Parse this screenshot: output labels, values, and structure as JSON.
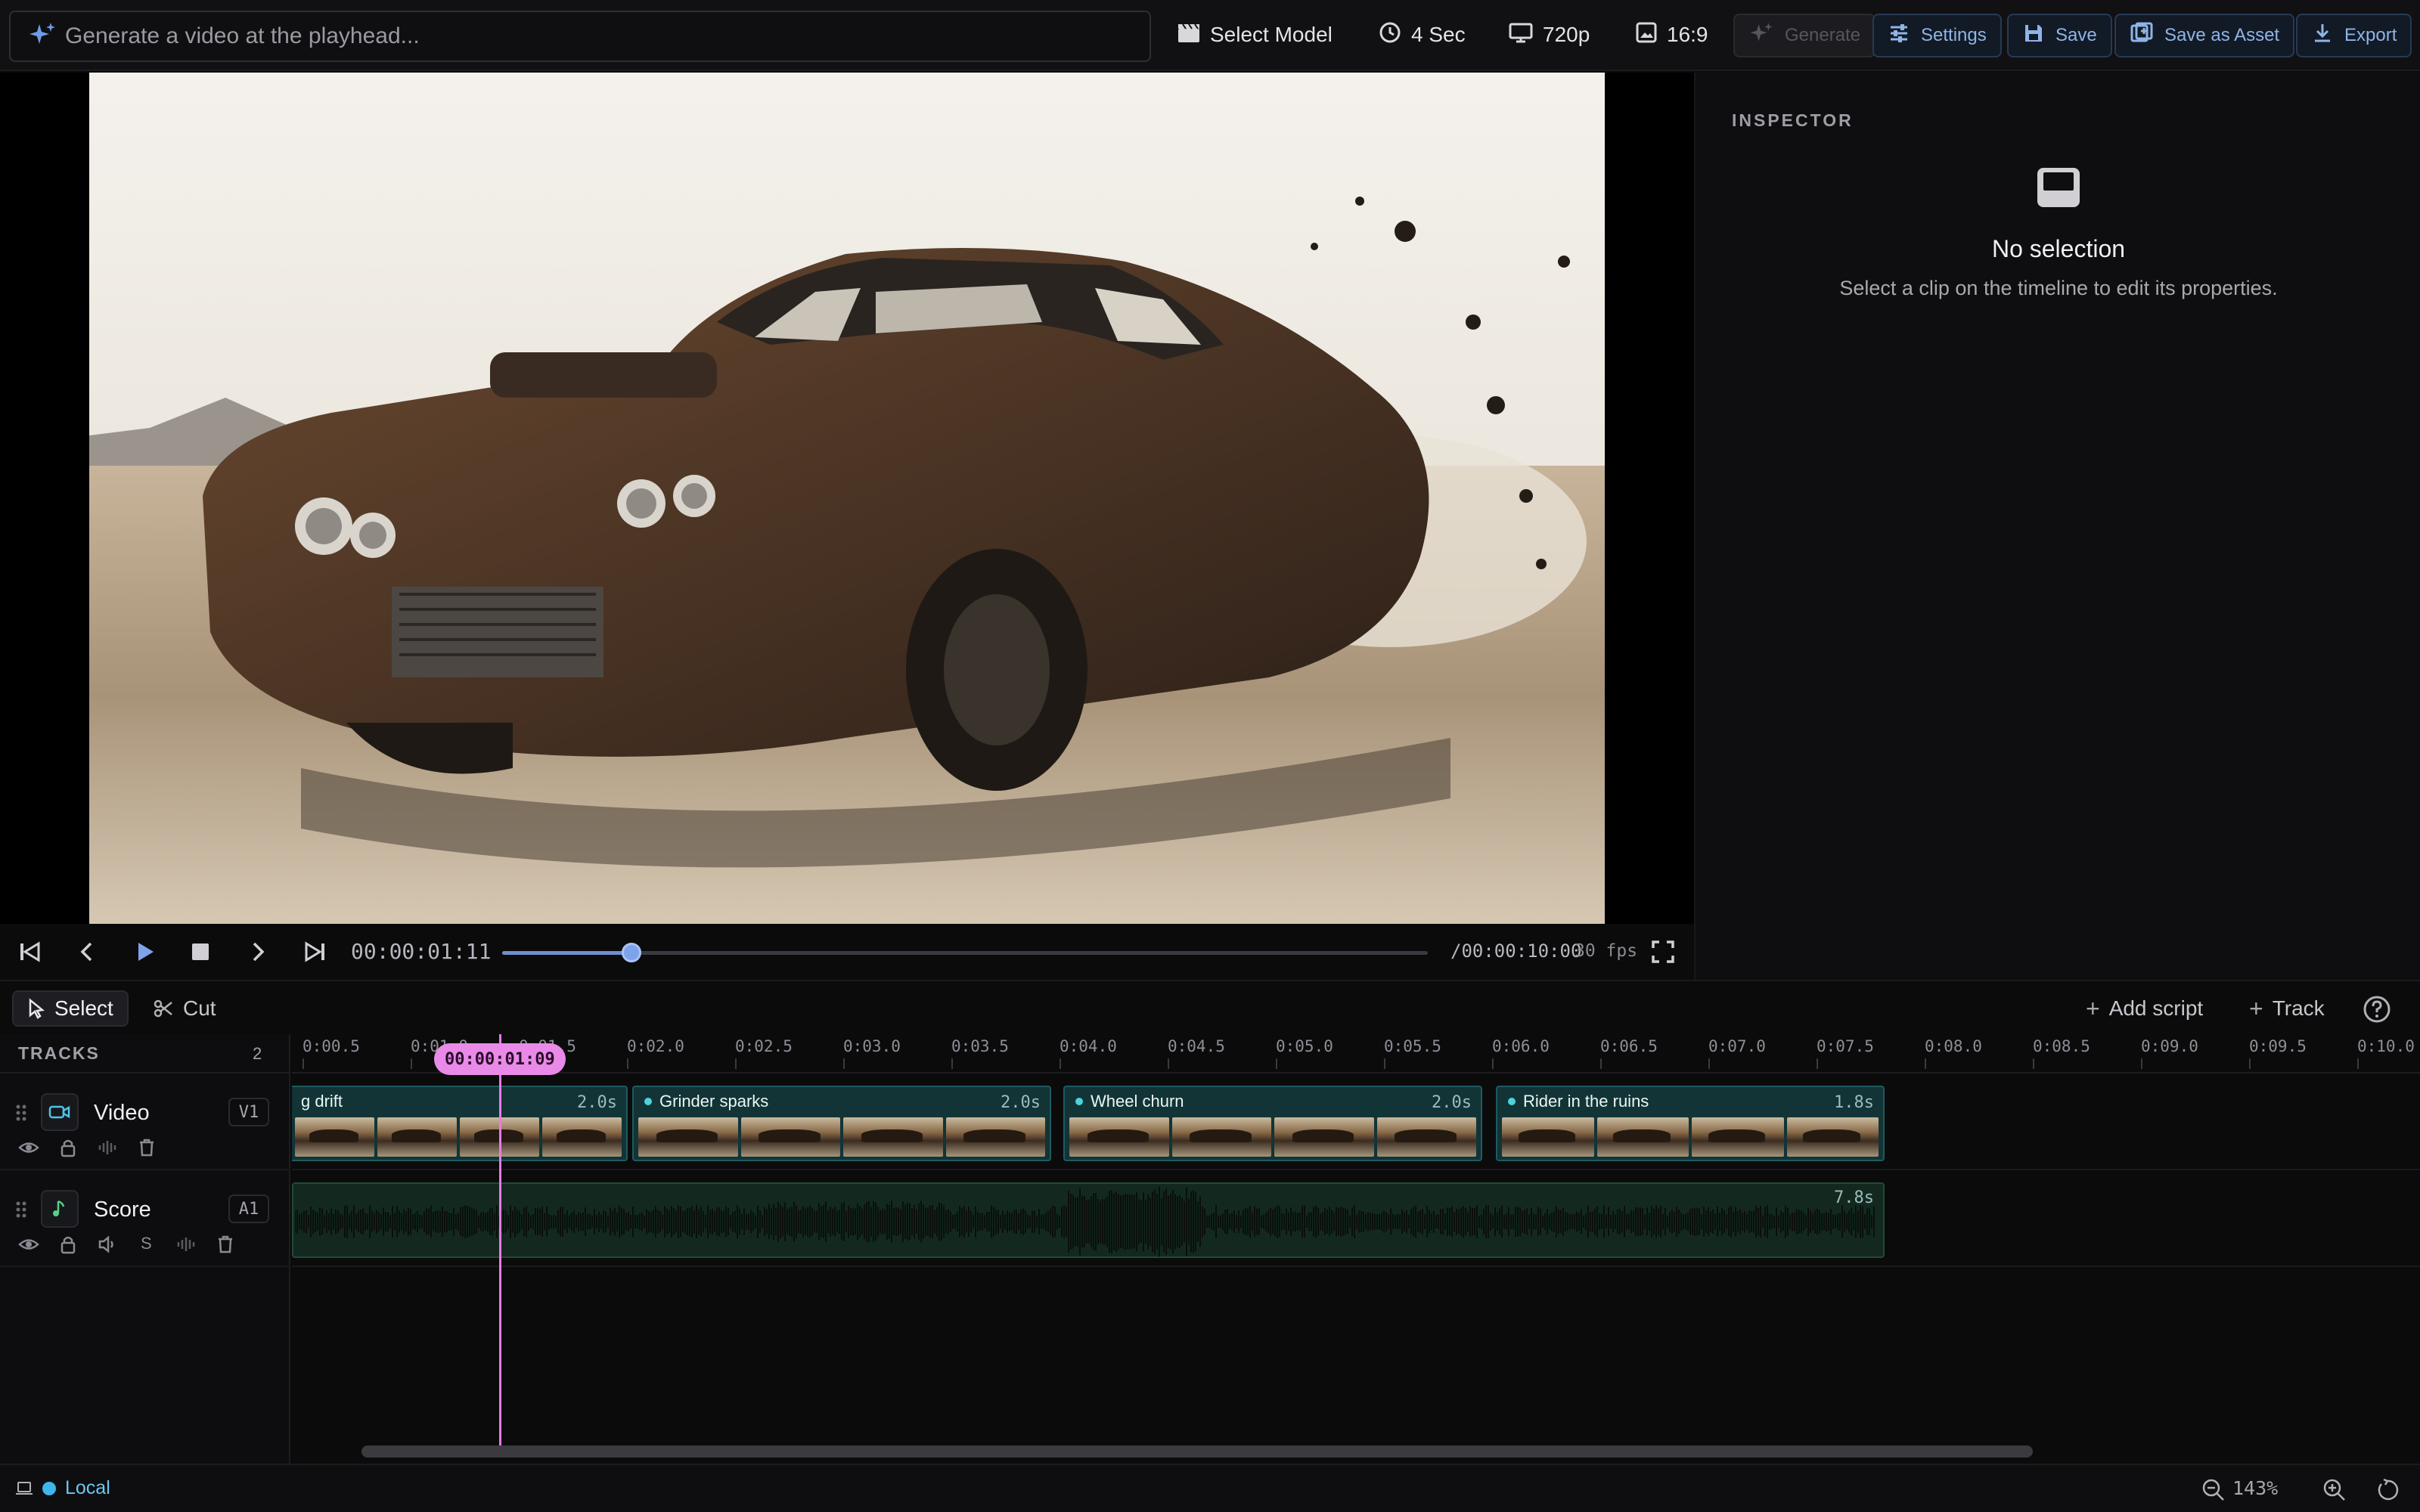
{
  "topbar": {
    "prompt_placeholder": "Generate a video at the playhead...",
    "model_label": "Select Model",
    "duration_label": "4 Sec",
    "resolution_label": "720p",
    "aspect_label": "16:9",
    "generate_label": "Generate",
    "settings_label": "Settings",
    "save_label": "Save",
    "save_asset_label": "Save as Asset",
    "export_label": "Export"
  },
  "transport": {
    "current_time": "00:00:01:11",
    "total_time": "/00:00:10:00",
    "fps": "30 fps",
    "progress": 0.14
  },
  "inspector": {
    "title": "INSPECTOR",
    "empty_title": "No selection",
    "empty_desc": "Select a clip on the timeline to edit its properties."
  },
  "timeline_toolbar": {
    "select_label": "Select",
    "cut_label": "Cut",
    "add_script_label": "Add script",
    "track_label": "Track"
  },
  "tracks": {
    "header": "TRACKS",
    "count": "2",
    "video": {
      "name": "Video",
      "badge": "V1"
    },
    "audio": {
      "name": "Score",
      "badge": "A1",
      "solo_label": "S"
    }
  },
  "ruler": {
    "labels": [
      "0:00.5",
      "0:01.0",
      "0:01.5",
      "0:02.0",
      "0:02.5",
      "0:03.0",
      "0:03.5",
      "0:04.0",
      "0:04.5",
      "0:05.0",
      "0:05.5",
      "0:06.0",
      "0:06.5",
      "0:07.0",
      "0:07.5",
      "0:08.0",
      "0:08.5",
      "0:09.0",
      "0:09.5",
      "0:10.0"
    ]
  },
  "playhead": {
    "label": "00:00:01:09"
  },
  "clips": {
    "video": [
      {
        "title": "g drift",
        "duration": "2.0s"
      },
      {
        "title": "Grinder sparks",
        "duration": "2.0s"
      },
      {
        "title": "Wheel churn",
        "duration": "2.0s"
      },
      {
        "title": "Rider in the ruins",
        "duration": "1.8s"
      }
    ],
    "audio": {
      "duration": "7.8s"
    }
  },
  "status": {
    "mode": "Local",
    "zoom": "143%"
  },
  "colors": {
    "accent": "#6f8fd0",
    "playhead": "#e98ae8",
    "video_clip": "#123437",
    "audio_clip": "#13291f",
    "status_local": "#3fb6ea"
  }
}
